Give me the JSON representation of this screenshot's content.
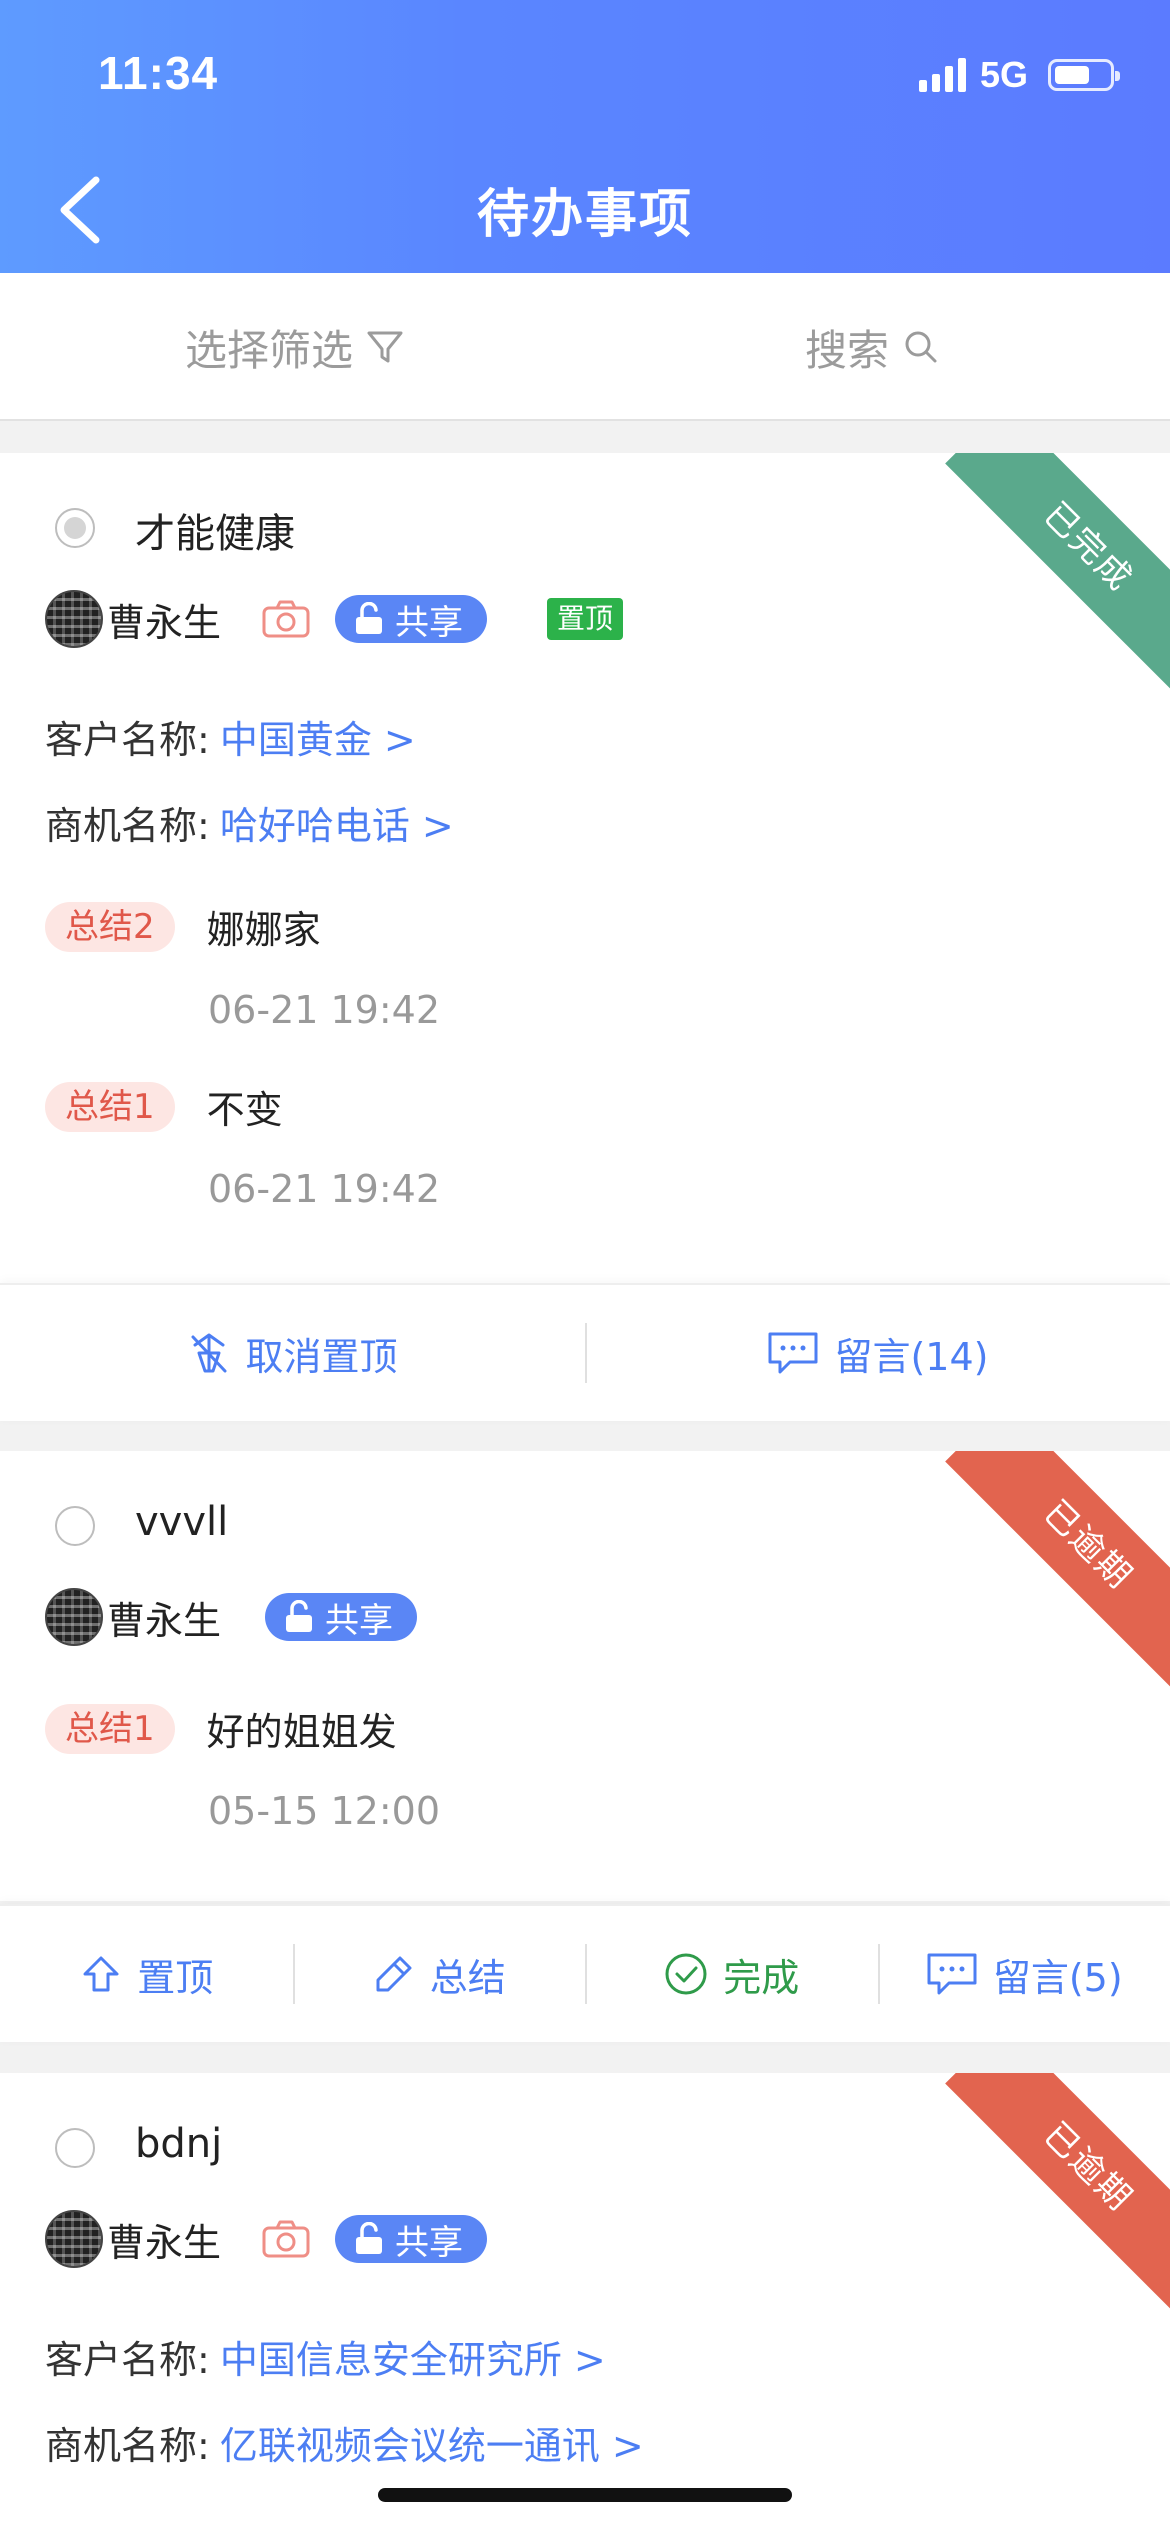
{
  "status_bar": {
    "time": "11:34",
    "network": "5G",
    "battery_level": 0.6
  },
  "header": {
    "title": "待办事项",
    "back_icon": "chevron-left-icon"
  },
  "filter_bar": {
    "filter_label": "选择筛选",
    "search_label": "搜索"
  },
  "colors": {
    "header_blue": "#5a86ff",
    "link_blue": "#4c7ef3",
    "done_green": "#5aa98c",
    "overdue_red": "#e2644f",
    "tag_green": "#2cb24a"
  },
  "cards": [
    {
      "status": "已完成",
      "title": "才能健康",
      "owner": "曹永生",
      "share_label": "共享",
      "top_tag": "置顶",
      "customer_label": "客户名称:",
      "customer_value": "中国黄金 >",
      "opportunity_label": "商机名称:",
      "opportunity_value": "哈好哈电话 >",
      "summaries": [
        {
          "tag": "总结2",
          "text": "娜娜家",
          "time": "06-21 19:42"
        },
        {
          "tag": "总结1",
          "text": "不变",
          "time": "06-21 19:42"
        }
      ],
      "actions": [
        {
          "label": "取消置顶",
          "icon": "unpin-icon"
        },
        {
          "label": "留言(14)",
          "icon": "comment-icon"
        }
      ]
    },
    {
      "status": "已逾期",
      "title": "vvvll",
      "owner": "曹永生",
      "share_label": "共享",
      "summaries": [
        {
          "tag": "总结1",
          "text": "好的姐姐发",
          "time": "05-15 12:00"
        }
      ],
      "actions": [
        {
          "label": "置顶",
          "icon": "pin-up-icon"
        },
        {
          "label": "总结",
          "icon": "pen-icon"
        },
        {
          "label": "完成",
          "icon": "check-circle-icon"
        },
        {
          "label": "留言(5)",
          "icon": "comment-icon"
        }
      ]
    },
    {
      "status": "已逾期",
      "title": "bdnj",
      "owner": "曹永生",
      "share_label": "共享",
      "customer_label": "客户名称:",
      "customer_value": "中国信息安全研究所 >",
      "opportunity_label": "商机名称:",
      "opportunity_value": "亿联视频会议统一通讯 >"
    }
  ]
}
